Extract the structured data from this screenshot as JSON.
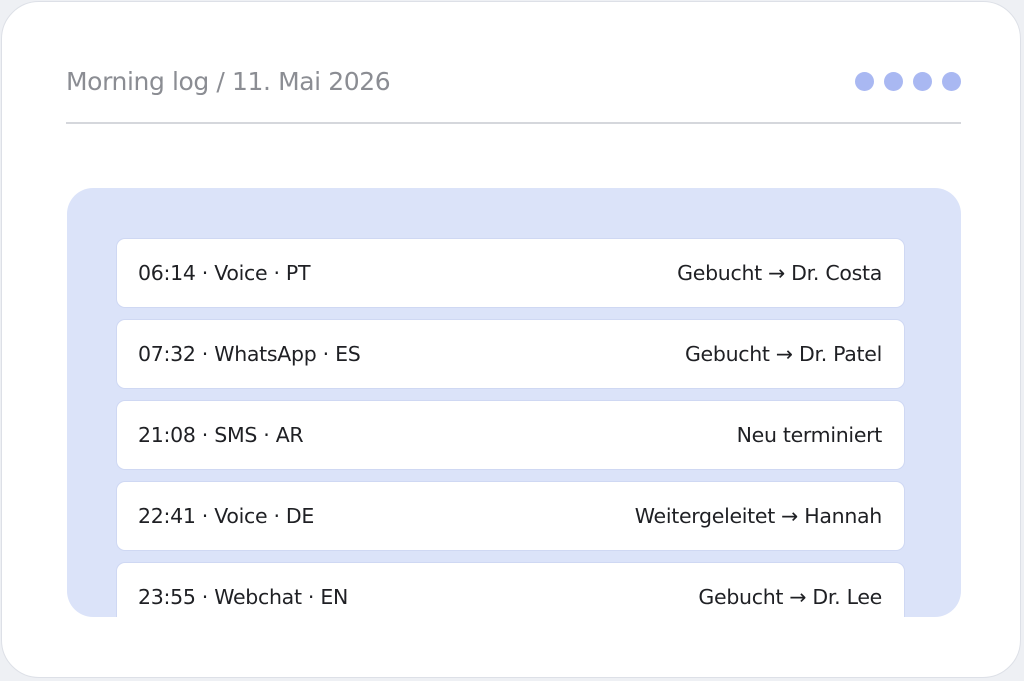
{
  "header": {
    "title": "Morning log / 11. Mai 2026",
    "dot_color": "#a9b8f2",
    "dots": [
      "indicator-1",
      "indicator-2",
      "indicator-3",
      "indicator-4"
    ]
  },
  "log": {
    "rows": [
      {
        "left": "06:14 · Voice · PT",
        "right": "Gebucht → Dr. Costa"
      },
      {
        "left": "07:32 · WhatsApp · ES",
        "right": "Gebucht → Dr. Patel"
      },
      {
        "left": "21:08 · SMS · AR",
        "right": "Neu terminiert"
      },
      {
        "left": "22:41 · Voice · DE",
        "right": "Weitergeleitet → Hannah"
      },
      {
        "left": "23:55 · Webchat · EN",
        "right": "Gebucht → Dr. Lee"
      }
    ]
  },
  "colors": {
    "panel_background": "#dbe3f9",
    "row_background": "#ffffff",
    "title_text": "#8b8d93"
  }
}
